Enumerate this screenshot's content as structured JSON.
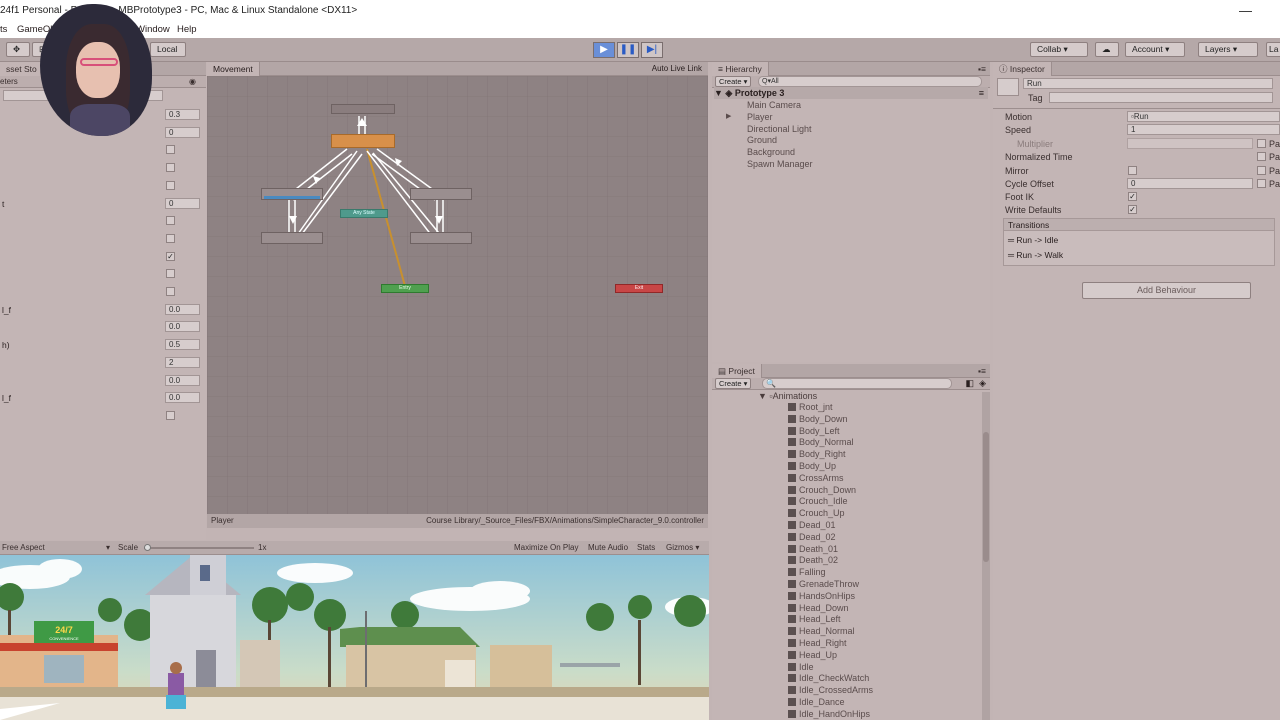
{
  "window": {
    "title": "24f1 Personal - Pr... ...ity - MBPrototype3 - PC, Mac & Linux Standalone <DX11>",
    "minimize": "—"
  },
  "menu": [
    "ts",
    "GameObj",
    "Window",
    "Help"
  ],
  "toolbar": {
    "local": "Local",
    "collab": "Collab ▾",
    "account": "Account",
    "layers": "Layers",
    "layout": "La"
  },
  "left_panel": {
    "tab_asset": "sset Sto",
    "tab_params": "eters",
    "values": [
      "0.3",
      "0",
      "",
      "",
      "",
      "0",
      "",
      "",
      "",
      "",
      "",
      "0.0",
      "0.0",
      "0.5",
      "2",
      "0.0",
      "0.0",
      ""
    ],
    "labels": [
      "",
      "",
      "",
      "",
      "",
      "t",
      "",
      "",
      "",
      "",
      "",
      "l_f",
      "",
      "h)",
      "",
      "",
      "l_f",
      ""
    ],
    "checks": [
      false,
      false,
      false,
      false,
      true,
      false,
      false,
      false,
      true,
      false,
      false,
      false
    ]
  },
  "animator": {
    "tab": "Movement",
    "auto_live_link": "Auto Live Link",
    "footer_left": "Player",
    "footer_right": "Course Library/_Source_Files/FBX/Animations/SimpleCharacter_9.0.controller",
    "nodes": {
      "any_state": "Any State",
      "entry": "Entry",
      "exit": "Exit"
    }
  },
  "game": {
    "aspect": "Free Aspect",
    "scale_label": "Scale",
    "scale_value": "1x",
    "maximize": "Maximize On Play",
    "mute": "Mute Audio",
    "stats": "Stats",
    "gizmos": "Gizmos ▾",
    "store_sign": "24/7",
    "store_sub": "CONVENIENCE"
  },
  "hierarchy": {
    "tab": "Hierarchy",
    "create": "Create ▾",
    "search": "Q▾All",
    "scene": "Prototype 3",
    "items": [
      "Main Camera",
      "Player",
      "Directional Light",
      "Ground",
      "Background",
      "Spawn Manager"
    ]
  },
  "project": {
    "tab": "Project",
    "create": "Create ▾",
    "folder": "Animations",
    "items": [
      "Root_jnt",
      "Body_Down",
      "Body_Left",
      "Body_Normal",
      "Body_Right",
      "Body_Up",
      "CrossArms",
      "Crouch_Down",
      "Crouch_Idle",
      "Crouch_Up",
      "Dead_01",
      "Dead_02",
      "Death_01",
      "Death_02",
      "Falling",
      "GrenadeThrow",
      "HandsOnHips",
      "Head_Down",
      "Head_Left",
      "Head_Normal",
      "Head_Right",
      "Head_Up",
      "Idle",
      "Idle_CheckWatch",
      "Idle_CrossedArms",
      "Idle_Dance",
      "Idle_HandOnHips"
    ]
  },
  "inspector": {
    "tab": "Inspector",
    "name": "Run",
    "tag_label": "Tag",
    "motion_label": "Motion",
    "motion_value": "Run",
    "speed_label": "Speed",
    "speed_value": "1",
    "multiplier_label": "Multiplier",
    "normalized_time_label": "Normalized Time",
    "mirror_label": "Mirror",
    "cycle_offset_label": "Cycle Offset",
    "cycle_offset_value": "0",
    "foot_ik_label": "Foot IK",
    "write_defaults_label": "Write Defaults",
    "transitions_label": "Transitions",
    "transitions": [
      "Run  ->  Idle",
      "Run  ->  Walk"
    ],
    "add_behaviour": "Add Behaviour",
    "param": "Pa"
  },
  "colors": {
    "orange_state": "#d8904a",
    "green_entry": "#4fa04f",
    "red_exit": "#c84646",
    "play_blue": "#2a5bc4"
  }
}
